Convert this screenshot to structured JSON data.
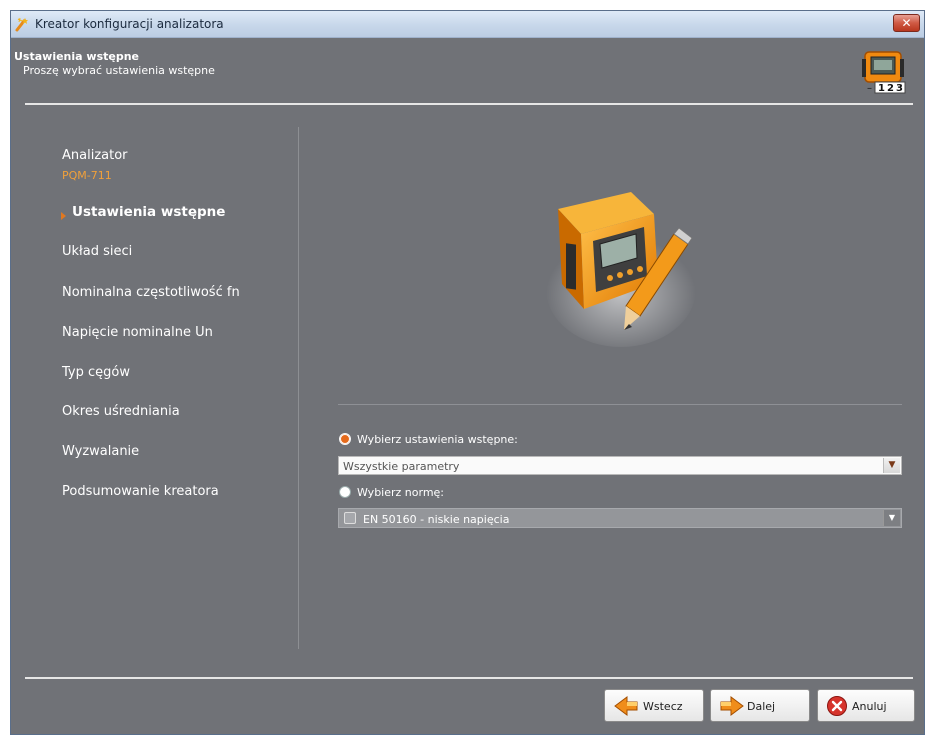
{
  "window": {
    "title": "Kreator konfiguracji analizatora"
  },
  "header": {
    "title": "Ustawienia wstępne",
    "subtitle": "Proszę wybrać ustawienia wstępne"
  },
  "nav": {
    "analyzer_label": "Analizator",
    "analyzer_model": "PQM-711",
    "items": [
      {
        "label": "Ustawienia wstępne",
        "active": true
      },
      {
        "label": "Układ sieci"
      },
      {
        "label": "Nominalna częstotliwość fn"
      },
      {
        "label": "Napięcie nominalne Un"
      },
      {
        "label": "Typ cęgów"
      },
      {
        "label": "Okres uśredniania"
      },
      {
        "label": "Wyzwalanie"
      },
      {
        "label": "Podsumowanie kreatora"
      }
    ]
  },
  "form": {
    "option1_label": "Wybierz ustawienia wstępne:",
    "option1_checked": true,
    "option1_value": "Wszystkie parametry",
    "option2_label": "Wybierz normę:",
    "option2_checked": false,
    "option2_value": "EN 50160 - niskie napięcia"
  },
  "footer": {
    "back_label": "Wstecz",
    "next_label": "Dalej",
    "cancel_label": "Anuluj"
  },
  "icons": {
    "app": "wizard-icon",
    "header": "analyzer-123-icon",
    "device": "analyzer-with-pen-illustration",
    "back": "arrow-left-icon",
    "next": "arrow-right-icon",
    "cancel": "cancel-x-icon"
  },
  "colors": {
    "background": "#707277",
    "accent": "#e66a1b",
    "model_text": "#f0a03a"
  }
}
